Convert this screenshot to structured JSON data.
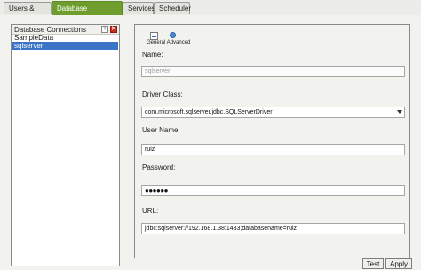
{
  "tabs": [
    {
      "label": "Users & Roles",
      "active": false
    },
    {
      "label": "Database Connections",
      "active": true
    },
    {
      "label": "Services",
      "active": false
    },
    {
      "label": "Scheduler",
      "active": false
    }
  ],
  "connections_panel": {
    "title": "Database Connections",
    "add_symbol": "+",
    "delete_symbol": "✕",
    "items": [
      {
        "label": "SampleData",
        "selected": false
      },
      {
        "label": "sqlserver",
        "selected": true
      }
    ]
  },
  "toolbar": {
    "icons": [
      "general-settings-icon",
      "advanced-settings-icon"
    ],
    "label": "General Advanced"
  },
  "form": {
    "name_label": "Name:",
    "name_value": "sqlserver",
    "driver_label": "Driver Class:",
    "driver_value": "com.microsoft.sqlserver.jdbc.SQLServerDriver",
    "user_label": "User Name:",
    "user_value": "ruiz",
    "password_label": "Password:",
    "password_value": "●●●●●●",
    "url_label": "URL:",
    "url_value": "jdbc:sqlserver://192.168.1.38:1433;databasename=ruiz"
  },
  "buttons": {
    "test": "Test",
    "apply": "Apply"
  },
  "colors": {
    "active_tab": "#6e9d2e",
    "selection": "#3b73c6",
    "delete_button": "#cc2b1f"
  }
}
